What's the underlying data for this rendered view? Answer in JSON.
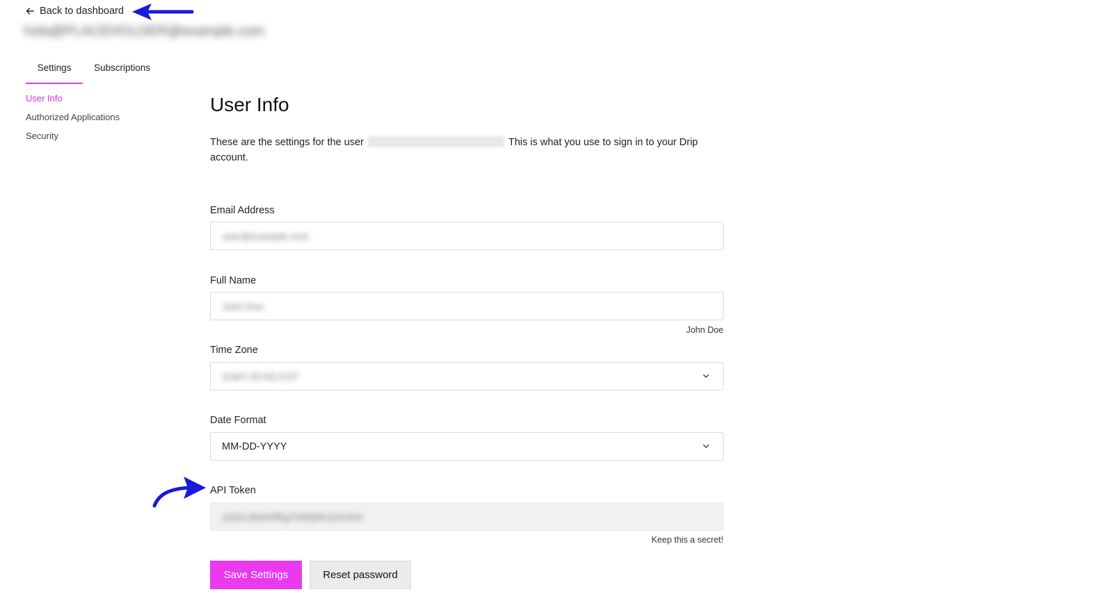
{
  "header": {
    "back_label": "Back to dashboard",
    "user_email": "hola@PLACEHOLDER@example.com"
  },
  "tabs": [
    {
      "label": "Settings",
      "active": true
    },
    {
      "label": "Subscriptions",
      "active": false
    }
  ],
  "sidebar": {
    "items": [
      {
        "label": "User Info",
        "active": true
      },
      {
        "label": "Authorized Applications",
        "active": false
      },
      {
        "label": "Security",
        "active": false
      }
    ]
  },
  "main": {
    "title": "User Info",
    "description_prefix": "These are the settings for the user",
    "description_suffix": "This is what you use to sign in to your Drip account.",
    "email": {
      "label": "Email Address",
      "value": "user@example.com"
    },
    "full_name": {
      "label": "Full Name",
      "value": "John Doe",
      "hint": "John Doe"
    },
    "time_zone": {
      "label": "Time Zone",
      "value": "(GMT-05:00) EST"
    },
    "date_format": {
      "label": "Date Format",
      "value": "MM-DD-YYYY"
    },
    "api_token": {
      "label": "API Token",
      "value": "a1b2c3d4e5f6g7h8i9j0k1l2m3n4",
      "hint": "Keep this a secret!"
    },
    "save_label": "Save Settings",
    "reset_label": "Reset password"
  },
  "colors": {
    "accent": "#e93af0",
    "annotation_arrow": "#1a1adb"
  }
}
